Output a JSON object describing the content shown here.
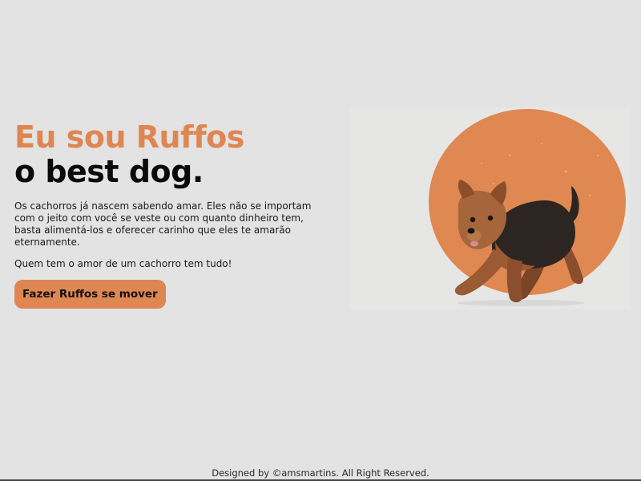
{
  "hero": {
    "title_highlight": "Eu sou Ruffos",
    "title_main": "o best dog.",
    "description": "Os cachorros já nascem sabendo amar. Eles não se importam com o jeito com você se veste ou com quanto dinheiro tem, basta alimentá-los e oferecer carinho que eles te amarão eternamente.",
    "tagline": "Quem tem o amor de um cachorro tem tudo!",
    "button_label": "Fazer Ruffos se mover"
  },
  "footer": {
    "credit": "Designed by ©amsmartins. All Right Reserved."
  },
  "colors": {
    "background": "#e2e3e2",
    "accent": "#df8652",
    "text": "#0a0a0a"
  },
  "icons": {
    "hero_image": "dog-illustration"
  }
}
